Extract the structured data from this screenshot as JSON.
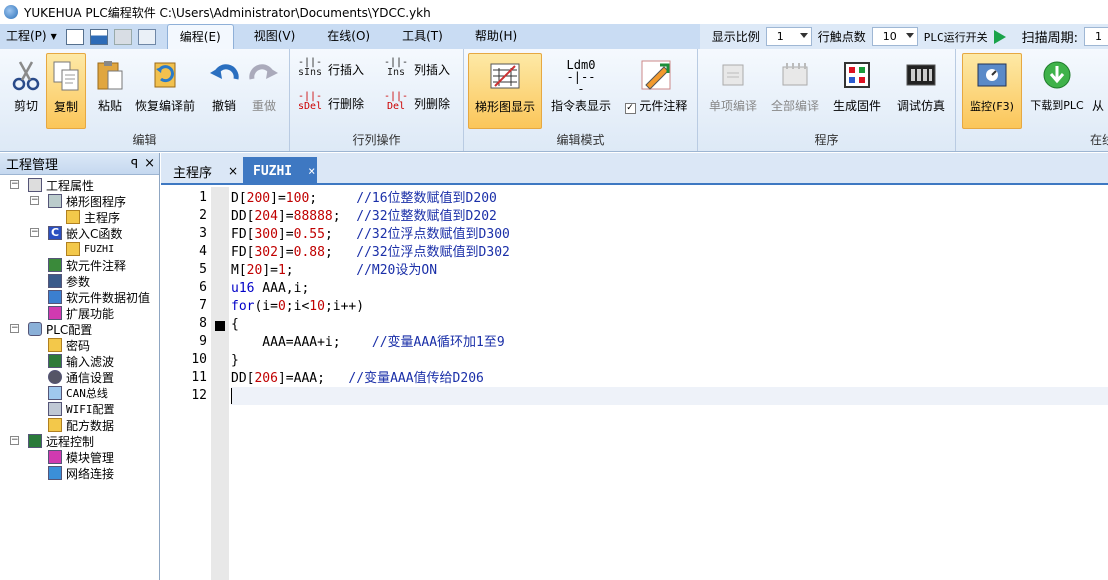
{
  "window": {
    "title": "YUKEHUA PLC编程软件 C:\\Users\\Administrator\\Documents\\YDCC.ykh"
  },
  "menu": {
    "project": "工程(P)",
    "tabs": [
      "编程(E)",
      "视图(V)",
      "在线(O)",
      "工具(T)",
      "帮助(H)"
    ],
    "display_ratio_label": "显示比例",
    "display_ratio_value": "1",
    "row_contacts_label": "行触点数",
    "row_contacts_value": "10",
    "plc_run_label": "PLC运行开关",
    "scan_period_label": "扫描周期:",
    "scan_period_value": "1"
  },
  "ribbon": {
    "edit_group": {
      "label": "编辑",
      "cut": "剪切",
      "copy": "复制",
      "paste": "粘贴",
      "restore": "恢复编译前",
      "undo": "撤销",
      "redo": "重做"
    },
    "rowcol_group": {
      "label": "行列操作",
      "row_insert": "行插入",
      "row_delete": "行删除",
      "col_insert": "列插入",
      "col_delete": "列删除",
      "sins_icon": "sIns",
      "sdel_icon": "sDel",
      "ins_icon": "Ins",
      "del_icon": "Del"
    },
    "mode_group": {
      "label": "编辑模式",
      "ladder": "梯形图显示",
      "instr": "指令表显示",
      "comment": "元件注释",
      "ldm_icon": "Ldm0"
    },
    "program_group": {
      "label": "程序",
      "single_compile": "单项编译",
      "all_compile": "全部编译",
      "gen_firmware": "生成固件",
      "debug_sim": "调试仿真"
    },
    "online_group": {
      "label": "在线",
      "monitor": "监控(F3)",
      "download": "下载到PLC",
      "more": "从"
    }
  },
  "left_panel": {
    "title": "工程管理",
    "pin": "ꟼ",
    "close": "×",
    "tree": [
      {
        "label": "工程属性"
      },
      {
        "label": "梯形图程序"
      },
      {
        "label": "主程序"
      },
      {
        "label": "嵌入C函数"
      },
      {
        "label": "FUZHI"
      },
      {
        "label": "软元件注释"
      },
      {
        "label": "参数"
      },
      {
        "label": "软元件数据初值"
      },
      {
        "label": "扩展功能"
      },
      {
        "label": "PLC配置"
      },
      {
        "label": "密码"
      },
      {
        "label": "输入滤波"
      },
      {
        "label": "通信设置"
      },
      {
        "label": "CAN总线"
      },
      {
        "label": "WIFI配置"
      },
      {
        "label": "配方数据"
      },
      {
        "label": "远程控制"
      },
      {
        "label": "模块管理"
      },
      {
        "label": "网络连接"
      }
    ]
  },
  "editor_tabs": [
    {
      "label": "主程序",
      "close": "×"
    },
    {
      "label": "FUZHI",
      "close": "×"
    }
  ],
  "code_lines": [
    {
      "num": "1",
      "text": "D[200]=100;     //16位整数赋值到D200"
    },
    {
      "num": "2",
      "text": "DD[204]=88888;  //32位整数赋值到D202"
    },
    {
      "num": "3",
      "text": "FD[300]=0.55;   //32位浮点数赋值到D300"
    },
    {
      "num": "4",
      "text": "FD[302]=0.88;   //32位浮点数赋值到D302"
    },
    {
      "num": "5",
      "text": "M[20]=1;        //M20设为ON"
    },
    {
      "num": "6",
      "text": "u16 AAA,i;"
    },
    {
      "num": "7",
      "text": "for(i=0;i<10;i++)"
    },
    {
      "num": "8",
      "text": "{"
    },
    {
      "num": "9",
      "text": "    AAA=AAA+i;    //变量AAA循环加1至9"
    },
    {
      "num": "10",
      "text": "}"
    },
    {
      "num": "11",
      "text": "DD[206]=AAA;   //变量AAA值传给D206"
    },
    {
      "num": "12",
      "text": ""
    }
  ]
}
